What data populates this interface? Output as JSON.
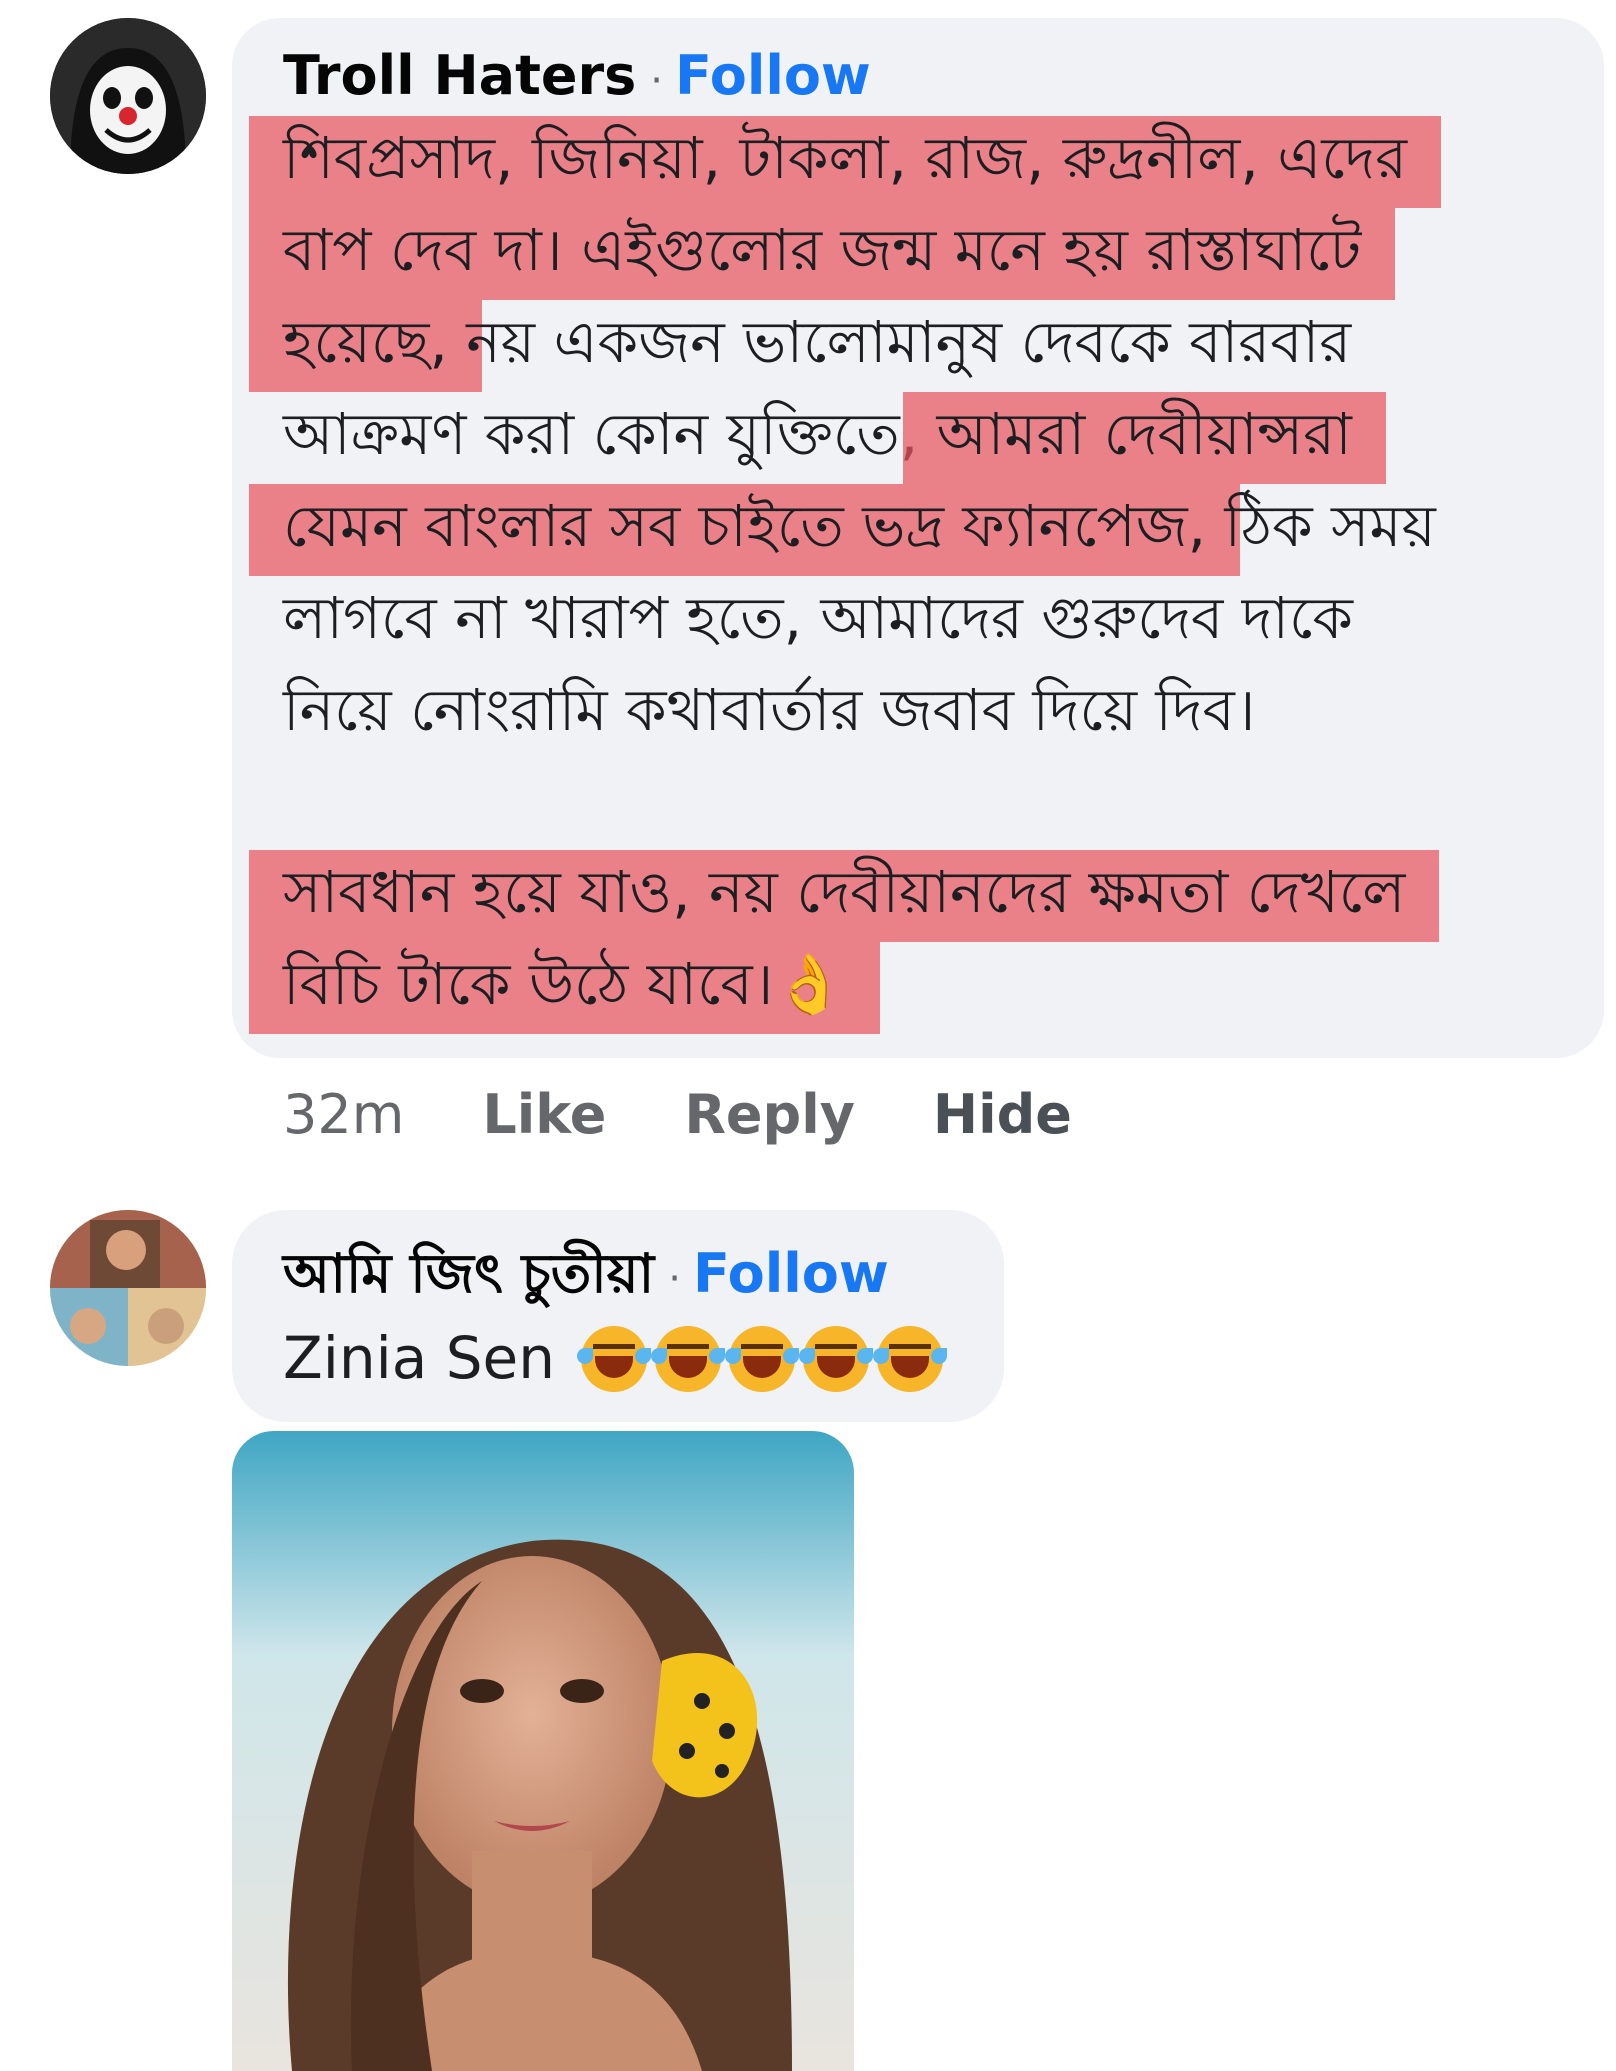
{
  "comment1": {
    "author": "Troll Haters",
    "separator": "·",
    "follow_label": "Follow",
    "lines": [
      "শিবপ্রসাদ, জিনিয়া, টাকলা, রাজ, রুদ্রনীল, এদের",
      "বাপ দেব দা।  এইগুলোর জন্ম মনে হয় রাস্তাঘাটে",
      "হয়েছে,",
      " নয় একজন ভালোমানুষ দেবকে বারবার",
      "আক্রমণ করা কোন যুক্তিতে, ",
      "আমরা দেবীয়ান্সরা",
      "যেমন বাংলার সব চাইতে ভদ্র ফ্যানপেজ,",
      " ঠিক সময়",
      "লাগবে না খারাপ হতে, আমাদের গুরুদেব দাকে",
      "নিয়ে নোংরামি কথাবার্তার জবাব দিয়ে দিব।",
      "সাবধান হয়ে যাও, নয় দেবীয়ানদের ক্ষমতা দেখলে",
      "বিচি টাকে উঠে যাবে।👌"
    ],
    "actions": {
      "time": "32m",
      "like": "Like",
      "reply": "Reply",
      "hide": "Hide"
    }
  },
  "comment2": {
    "author": "আমি জিৎ চুতীয়া",
    "separator": "·",
    "follow_label": "Follow",
    "text": "Zinia Sen",
    "emojis": [
      "rofl-emoji",
      "rofl-emoji",
      "rofl-emoji",
      "joy-emoji",
      "joy-emoji"
    ]
  },
  "colors": {
    "bubble": "#f0f2f5",
    "follow": "#1877f2",
    "highlight": "#e85460",
    "meta": "#65676b"
  }
}
